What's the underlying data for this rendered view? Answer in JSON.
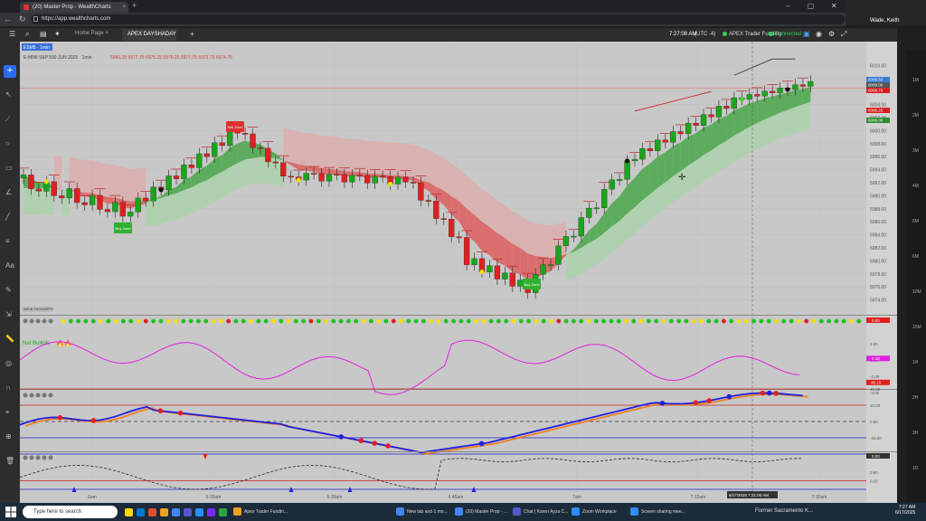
{
  "browser": {
    "tab_title": "(20) Master Prop - WealthCharts",
    "url": "https://app.wealthcharts.com"
  },
  "zoom": {
    "participant_name": "Wade, Keith",
    "strip_labels": [
      "1M",
      "2M",
      "3M",
      "4M",
      "5M",
      "6M",
      "10M",
      "15M",
      "1H",
      "2H",
      "3H",
      "1D"
    ]
  },
  "app": {
    "tabs": [
      {
        "label": "Home Page"
      },
      {
        "label": "APEX DAYSHADAY"
      }
    ],
    "clock": "7:27:08 AM",
    "timezone": "(UTC -4)",
    "broker": "APEX Trader Funding",
    "connection": "Connected"
  },
  "chart": {
    "symbol": "ESM5 · 1min",
    "title": "E-MINI S&P 500 JUN 2025 · 1min",
    "ohlc_line": "5980.25 5977.75 5975.25 5970.25 5977.75 5973.75 5974.75",
    "price_ticks": [
      "6010.00",
      "6008.00",
      "6006.00",
      "6004.00",
      "6002.00",
      "6000.00",
      "5998.00",
      "5996.00",
      "5994.00",
      "5992.00",
      "5990.00",
      "5988.00",
      "5986.00",
      "5984.00",
      "5982.00",
      "5980.00",
      "5978.00",
      "5976.00",
      "5974.00"
    ],
    "price_tags": [
      {
        "label": "6009.50",
        "color": "#3a7bd5"
      },
      {
        "label": "6008.00",
        "color": "#555555"
      },
      {
        "label": "6008.75",
        "color": "#d62020"
      },
      {
        "label": "6006.25",
        "color": "#d62020"
      },
      {
        "label": "6006.00",
        "color": "#2e8b2e"
      }
    ],
    "annotations": {
      "sell_zone": "Sell Zone",
      "buy_zone_1": "Buy Zone",
      "buy_zone_2": "Buy Zone"
    },
    "time_labels": [
      "6am",
      "6:15am",
      "6:30am",
      "6:45am",
      "7am",
      "7:15am",
      "7:30am"
    ],
    "crosshair_time": "6/17/2025 7:21:00 AM",
    "panel_brand": "WEALTHCHARTS",
    "net_bullish": "Net Bullish:",
    "osc1": {
      "ticks": [
        "2.00",
        "0.00",
        "-2.00",
        "-4.00"
      ],
      "tag": "0.19"
    },
    "osc2": {
      "ticks": [
        "40.00",
        "20.00",
        "0.00",
        "-20.00",
        "-40.00"
      ],
      "tag": "48.10"
    },
    "osc3": {
      "ticks": [
        "0.50",
        "0.25"
      ],
      "tag": "0.00"
    },
    "dots_tag": "0.00"
  },
  "taskbar": {
    "search_placeholder": "Type here to search",
    "apps": [
      {
        "label": "Apex Trader Fundin...",
        "color": "#f0a020"
      },
      {
        "label": "New tab and 1 mo...",
        "color": "#4285f4"
      },
      {
        "label": "(20) Master Prop - ...",
        "color": "#4285f4"
      },
      {
        "label": "Chat | Karen Ayza C...",
        "color": "#5059c9"
      },
      {
        "label": "Zoom Workplace",
        "color": "#2d8cff"
      },
      {
        "label": "Screen sharing mee...",
        "color": "#2d8cff"
      }
    ],
    "news": "Former Sacramento K...",
    "time": "7:27 AM",
    "date": "6/17/2025"
  },
  "colors": {
    "bull": "#1aa51a",
    "bear": "#e02020",
    "cloud_green": "#3aa33a",
    "cloud_red": "#e05050",
    "magenta": "#e020e0",
    "blue": "#2020e0",
    "orange": "#f08020"
  }
}
